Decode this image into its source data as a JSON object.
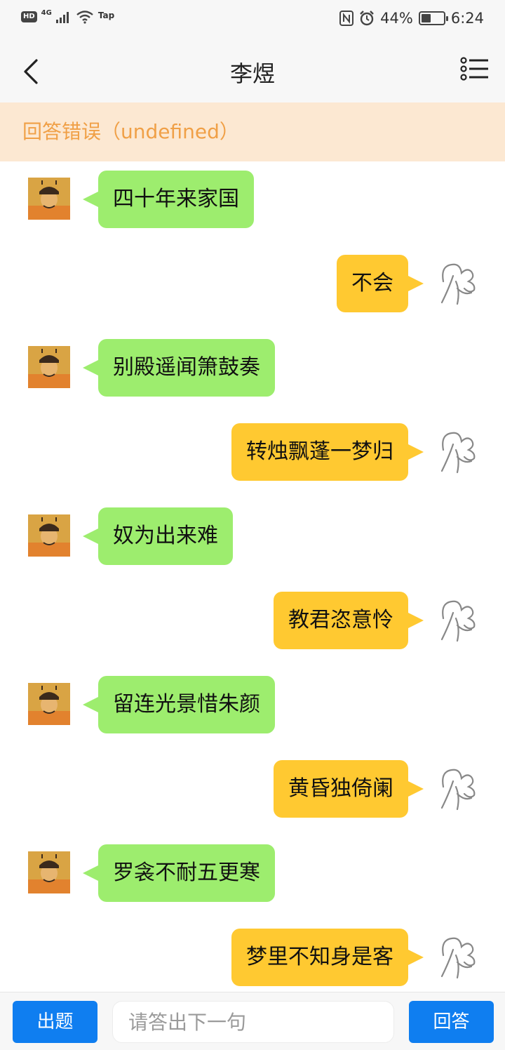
{
  "status_bar": {
    "hd": "HD",
    "network": "4G",
    "tap": "Tap",
    "battery": "44%",
    "battery_level": 0.44,
    "time": "6:24",
    "icons": [
      "nfc-icon",
      "alarm-icon",
      "battery-icon",
      "wifi-icon",
      "signal-icon"
    ]
  },
  "header": {
    "title": "李煜",
    "back_icon": "back-chevron-icon",
    "menu_icon": "list-menu-icon"
  },
  "banner": {
    "text": "回答错误（undefined）"
  },
  "messages": [
    {
      "side": "left",
      "text": "四十年来家国"
    },
    {
      "side": "right",
      "text": "不会"
    },
    {
      "side": "left",
      "text": "别殿遥闻箫鼓奏"
    },
    {
      "side": "right",
      "text": "转烛飘蓬一梦归"
    },
    {
      "side": "left",
      "text": "奴为出来难"
    },
    {
      "side": "right",
      "text": "教君恣意怜"
    },
    {
      "side": "left",
      "text": "留连光景惜朱颜"
    },
    {
      "side": "right",
      "text": "黄昏独倚阑"
    },
    {
      "side": "left",
      "text": "罗衾不耐五更寒"
    },
    {
      "side": "right",
      "text": "梦里不知身是客"
    }
  ],
  "bottom_bar": {
    "ask_label": "出题",
    "input_placeholder": "请答出下一句",
    "input_value": "",
    "answer_label": "回答"
  },
  "colors": {
    "poet_bubble": "#9ded6e",
    "user_bubble": "#ffc931",
    "banner_bg": "#fce8d2",
    "banner_text": "#f0a047",
    "button": "#0f7ef0"
  }
}
